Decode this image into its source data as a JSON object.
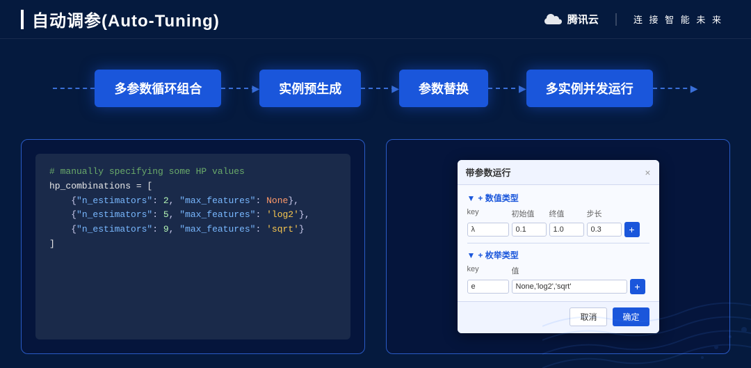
{
  "header": {
    "bar": "",
    "title": "自动调参(Auto-Tuning)",
    "brand_name": "腾讯云",
    "brand_divider": "｜",
    "brand_slogan": "连 接 智 能 未 来"
  },
  "pipeline": {
    "steps": [
      {
        "label": "多参数循环组合"
      },
      {
        "label": "实例预生成"
      },
      {
        "label": "参数替换"
      },
      {
        "label": "多实例并发运行"
      }
    ]
  },
  "code_panel": {
    "lines": [
      {
        "type": "comment",
        "text": "# manually specifying some HP values"
      },
      {
        "type": "var",
        "text": "hp_combinations = ["
      },
      {
        "type": "dict",
        "text": "    {\"n_estimators\": 2, \"max_features\": None},"
      },
      {
        "type": "dict",
        "text": "    {\"n_estimators\": 5, \"max_features\": 'log2'},"
      },
      {
        "type": "dict",
        "text": "    {\"n_estimators\": 9, \"max_features\": 'sqrt'}"
      },
      {
        "type": "bracket",
        "text": "]"
      }
    ]
  },
  "dialog": {
    "title": "带参数运行",
    "close_icon": "×",
    "section1": {
      "label": "+ 数值类型",
      "headers": [
        "key",
        "初始值",
        "终值",
        "步长"
      ],
      "row": {
        "key": "λ",
        "start": "0.1",
        "end": "1.0",
        "step": "0.3"
      },
      "add_btn": "+"
    },
    "section2": {
      "label": "+ 枚举类型",
      "headers": [
        "key",
        "值"
      ],
      "row": {
        "key": "e",
        "value": "None,'log2','sqrt'"
      },
      "add_btn": "+"
    },
    "footer": {
      "cancel": "取消",
      "confirm": "确定"
    }
  }
}
